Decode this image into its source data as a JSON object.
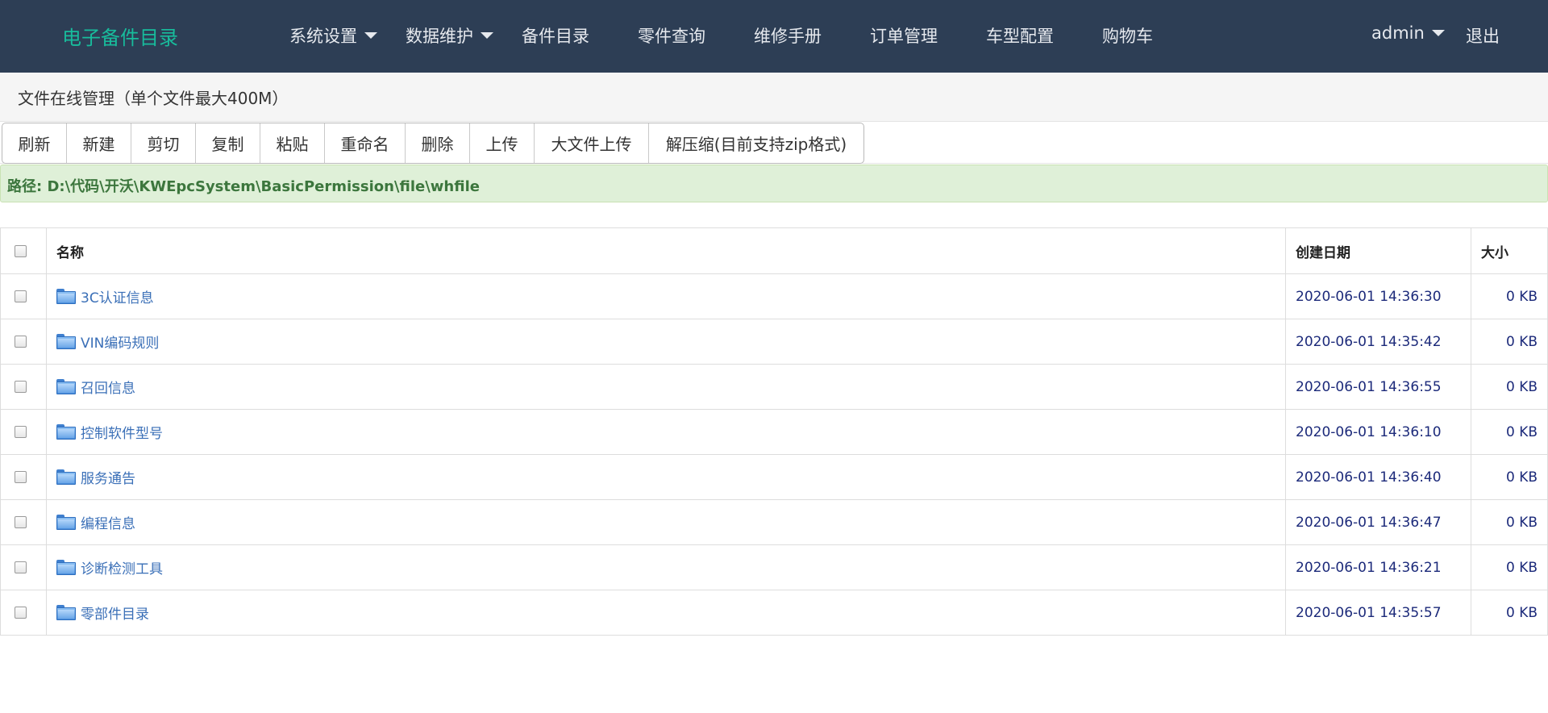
{
  "navbar": {
    "brand": "电子备件目录",
    "items": [
      {
        "label": "系统设置",
        "dropdown": true
      },
      {
        "label": "数据维护",
        "dropdown": true
      },
      {
        "label": "备件目录",
        "dropdown": false
      },
      {
        "label": "零件查询",
        "dropdown": false
      },
      {
        "label": "维修手册",
        "dropdown": false
      },
      {
        "label": "订单管理",
        "dropdown": false
      },
      {
        "label": "车型配置",
        "dropdown": false
      },
      {
        "label": "购物车",
        "dropdown": false
      }
    ],
    "user": "admin",
    "logout": "退出"
  },
  "title": "文件在线管理（单个文件最大400M）",
  "toolbar": {
    "buttons": [
      "刷新",
      "新建",
      "剪切",
      "复制",
      "粘贴",
      "重命名",
      "删除",
      "上传",
      "大文件上传",
      "解压缩(目前支持zip格式)"
    ]
  },
  "path": "路径: D:\\代码\\开沃\\KWEpcSystem\\BasicPermission\\file\\whfile",
  "table": {
    "headers": {
      "name": "名称",
      "date": "创建日期",
      "size": "大小"
    },
    "rows": [
      {
        "name": "3C认证信息",
        "date": "2020-06-01 14:36:30",
        "size": "0 KB"
      },
      {
        "name": "VIN编码规则",
        "date": "2020-06-01 14:35:42",
        "size": "0 KB"
      },
      {
        "name": "召回信息",
        "date": "2020-06-01 14:36:55",
        "size": "0 KB"
      },
      {
        "name": "控制软件型号",
        "date": "2020-06-01 14:36:10",
        "size": "0 KB"
      },
      {
        "name": "服务通告",
        "date": "2020-06-01 14:36:40",
        "size": "0 KB"
      },
      {
        "name": "编程信息",
        "date": "2020-06-01 14:36:47",
        "size": "0 KB"
      },
      {
        "name": "诊断检测工具",
        "date": "2020-06-01 14:36:21",
        "size": "0 KB"
      },
      {
        "name": "零部件目录",
        "date": "2020-06-01 14:35:57",
        "size": "0 KB"
      }
    ]
  },
  "icons": {
    "folder": "folder-icon",
    "dropdown": "caret-down-icon",
    "checkbox": "checkbox"
  },
  "colors": {
    "navbar": "#2d3e55",
    "brand": "#18bc9c",
    "path_bg": "#dff0d8",
    "path_text": "#3c763d",
    "link": "#3a6fb7"
  }
}
